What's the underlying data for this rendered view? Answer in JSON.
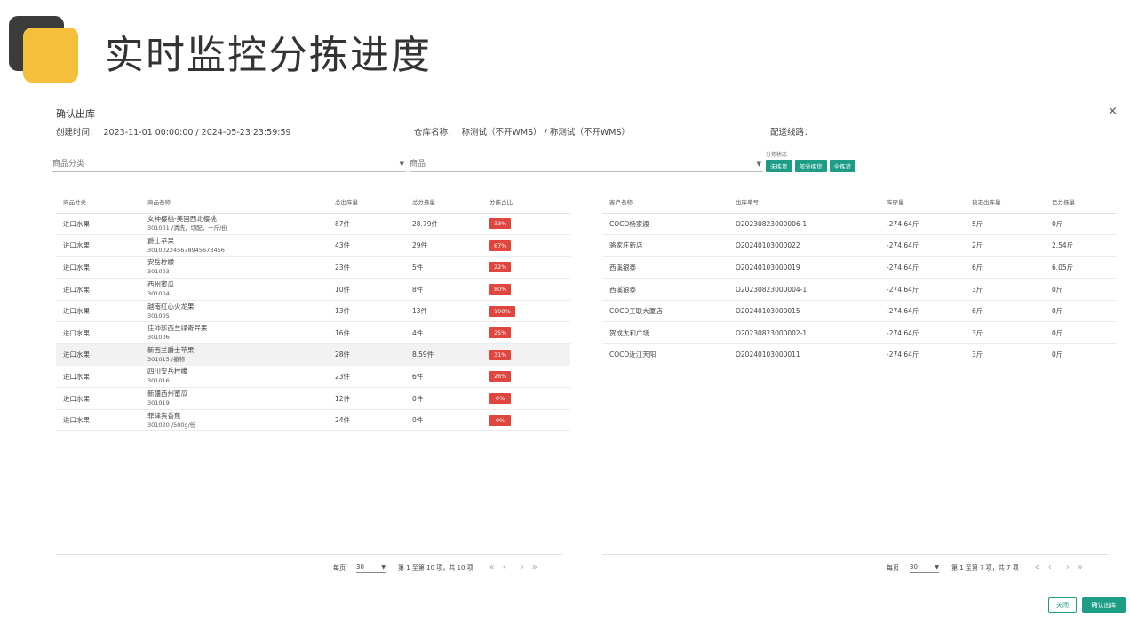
{
  "slide_title": "实时监控分拣进度",
  "dialog": {
    "title": "确认出库",
    "close_icon": "×",
    "create_time_label": "创建时间：",
    "create_time_value": "2023-11-01 00:00:00 / 2024-05-23 23:59:59",
    "warehouse_label": "仓库名称：",
    "warehouse_value": "称测试（不开WMS） / 称测试（不开WMS）",
    "route_label": "配送线路："
  },
  "filters": {
    "category_placeholder": "商品分类",
    "product_placeholder": "商品",
    "status_label": "分拣状态",
    "status_buttons": [
      "未拣货",
      "部分拣货",
      "全拣货"
    ]
  },
  "left_table": {
    "headers": [
      "商品分类",
      "商品名称",
      "总出库量",
      "总分拣量",
      "分拣占比"
    ],
    "rows": [
      {
        "category": "进口水果",
        "name": "女神樱桃-美国西北樱桃",
        "code": "301001 /清洗，切配，一斤/份",
        "total_out": "87件",
        "total_sorted": "28.79件",
        "ratio": "33%"
      },
      {
        "category": "进口水果",
        "name": "爵士苹果",
        "code": "30100224567894567345​6",
        "total_out": "43件",
        "total_sorted": "29件",
        "ratio": "67%"
      },
      {
        "category": "进口水果",
        "name": "安岳柠檬",
        "code": "301003",
        "total_out": "23件",
        "total_sorted": "5件",
        "ratio": "22%"
      },
      {
        "category": "进口水果",
        "name": "西州蜜瓜",
        "code": "301004",
        "total_out": "10件",
        "total_sorted": "8件",
        "ratio": "80%"
      },
      {
        "category": "进口水果",
        "name": "越南红心火龙果",
        "code": "301005",
        "total_out": "13件",
        "total_sorted": "13件",
        "ratio": "100%"
      },
      {
        "category": "进口水果",
        "name": "佳沛新西兰绿奇异果",
        "code": "301006",
        "total_out": "16件",
        "total_sorted": "4件",
        "ratio": "25%"
      },
      {
        "category": "进口水果",
        "name": "新西兰爵士苹果",
        "code": "301015 /撤称",
        "total_out": "28件",
        "total_sorted": "8.59件",
        "ratio": "31%"
      },
      {
        "category": "进口水果",
        "name": "四川安岳柠檬",
        "code": "301016",
        "total_out": "23件",
        "total_sorted": "6件",
        "ratio": "26%"
      },
      {
        "category": "进口水果",
        "name": "新疆西州蜜瓜",
        "code": "301019",
        "total_out": "12件",
        "total_sorted": "0件",
        "ratio": "0%"
      },
      {
        "category": "进口水果",
        "name": "菲律宾香蕉",
        "code": "301020 /500g/份",
        "total_out": "24件",
        "total_sorted": "0件",
        "ratio": "0%"
      }
    ],
    "pager": {
      "per_page_label": "每页",
      "per_page_value": "30",
      "summary": "第 1 至第 10 项，共 10 项"
    }
  },
  "right_table": {
    "headers": [
      "客户名称",
      "出库单号",
      "库存量",
      "锁定出库量",
      "已分拣量"
    ],
    "rows": [
      {
        "customer": "COCO杨家渡",
        "order": "O20230823000006-1",
        "stock": "-274.64斤",
        "locked": "5斤",
        "sorted": "0斤"
      },
      {
        "customer": "骆家庄新店",
        "order": "O20240103000022",
        "stock": "-274.64斤",
        "locked": "2斤",
        "sorted": "2.54斤"
      },
      {
        "customer": "西溪银泰",
        "order": "O20240103000019",
        "stock": "-274.64斤",
        "locked": "6斤",
        "sorted": "6.05斤"
      },
      {
        "customer": "西溪银泰",
        "order": "O20230823000004-1",
        "stock": "-274.64斤",
        "locked": "3斤",
        "sorted": "0斤"
      },
      {
        "customer": "COCO工联大厦店",
        "order": "O20240103000015",
        "stock": "-274.64斤",
        "locked": "6斤",
        "sorted": "0斤"
      },
      {
        "customer": "贺成太和广场",
        "order": "O20230823000002-1",
        "stock": "-274.64斤",
        "locked": "3斤",
        "sorted": "0斤"
      },
      {
        "customer": "COCO近江天阳",
        "order": "O20240103000011",
        "stock": "-274.64斤",
        "locked": "3斤",
        "sorted": "0斤"
      }
    ],
    "pager": {
      "per_page_label": "每页",
      "per_page_value": "30",
      "summary": "第 1 至第 7 项，共 7 项"
    }
  },
  "pager_nav": {
    "first": "«",
    "prev": "‹",
    "next": "›",
    "last": "»"
  },
  "footer": {
    "close_label": "关闭",
    "confirm_label": "确认出库"
  },
  "colors": {
    "accent": "#1d9c86",
    "badge": "#e0463e",
    "deco_yellow": "#f5bf3b",
    "deco_dark": "#3b3b3b"
  }
}
